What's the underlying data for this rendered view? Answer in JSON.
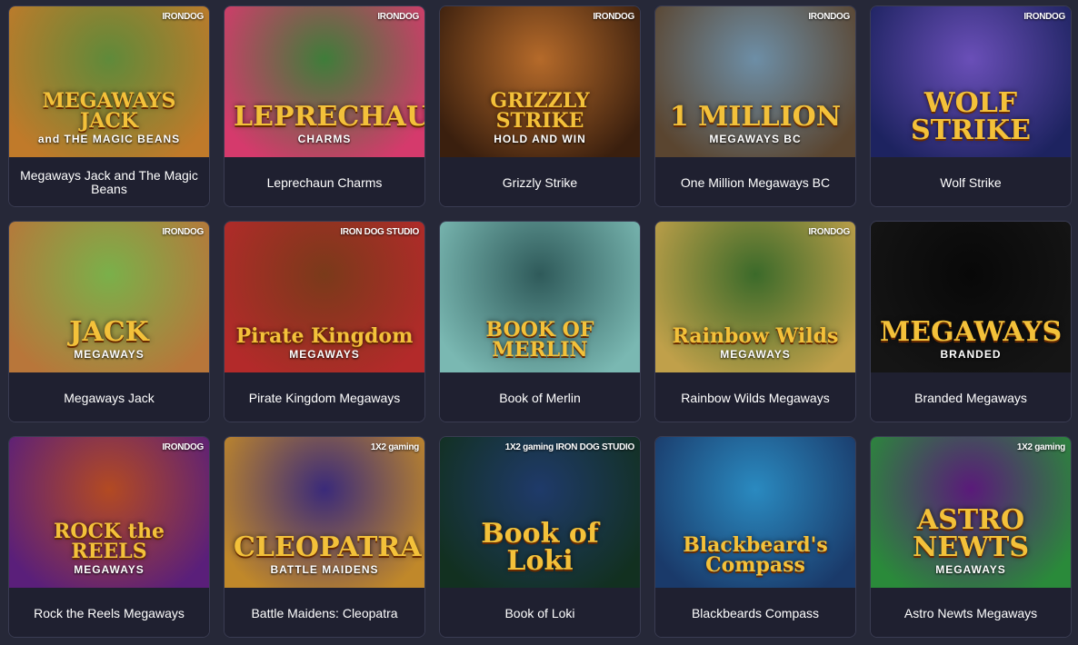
{
  "games": [
    {
      "title": "Megaways Jack and The Magic Beans",
      "logo": "MEGAWAYS JACK",
      "logo_sub": "and THE MAGIC BEANS",
      "provider": "IRONDOG",
      "bg": [
        "#5f8a3a",
        "#c07a2a"
      ]
    },
    {
      "title": "Leprechaun Charms",
      "logo": "LEPRECHAUN",
      "logo_sub": "CHARMS",
      "provider": "IRONDOG",
      "bg": [
        "#3f7d3a",
        "#d53a6c"
      ]
    },
    {
      "title": "Grizzly Strike",
      "logo": "GRIZZLY STRIKE",
      "logo_sub": "HOLD AND WIN",
      "provider": "IRONDOG",
      "bg": [
        "#b56a2a",
        "#3a1f0e"
      ]
    },
    {
      "title": "One Million Megaways BC",
      "logo": "1 MILLION",
      "logo_sub": "MEGAWAYS BC",
      "provider": "IRONDOG",
      "bg": [
        "#6d8ea6",
        "#5a4530"
      ]
    },
    {
      "title": "Wolf Strike",
      "logo": "WOLF STRIKE",
      "logo_sub": "",
      "provider": "IRONDOG",
      "bg": [
        "#6a4fb8",
        "#1d2360"
      ]
    },
    {
      "title": "Megaways Jack",
      "logo": "JACK",
      "logo_sub": "MEGAWAYS",
      "provider": "IRONDOG",
      "bg": [
        "#7ab04a",
        "#b8763a"
      ]
    },
    {
      "title": "Pirate Kingdom Megaways",
      "logo": "Pirate Kingdom",
      "logo_sub": "MEGAWAYS",
      "provider": "IRON DOG STUDIO",
      "bg": [
        "#7a3a1a",
        "#b32a2a"
      ]
    },
    {
      "title": "Book of Merlin",
      "logo": "BOOK OF MERLIN",
      "logo_sub": "",
      "provider": "",
      "bg": [
        "#2f5a5a",
        "#7ab8b2"
      ]
    },
    {
      "title": "Rainbow Wilds Megaways",
      "logo": "Rainbow Wilds",
      "logo_sub": "MEGAWAYS",
      "provider": "IRONDOG",
      "bg": [
        "#3b6a2a",
        "#c0a04a"
      ]
    },
    {
      "title": "Branded Megaways",
      "logo": "MEGAWAYS",
      "logo_sub": "BRANDED",
      "provider": "",
      "bg": [
        "#080808",
        "#151515"
      ]
    },
    {
      "title": "Rock the Reels Megaways",
      "logo": "ROCK the REELS",
      "logo_sub": "MEGAWAYS",
      "provider": "IRONDOG",
      "bg": [
        "#b34a22",
        "#5a1f7a"
      ]
    },
    {
      "title": "Battle Maidens: Cleopatra",
      "logo": "CLEOPATRA",
      "logo_sub": "BATTLE MAIDENS",
      "provider": "1X2 gaming",
      "bg": [
        "#3a2a7a",
        "#c0882a"
      ]
    },
    {
      "title": "Book of Loki",
      "logo": "Book of Loki",
      "logo_sub": "",
      "provider": "1X2 gaming IRON DOG STUDIO",
      "bg": [
        "#1f3a6a",
        "#123020"
      ]
    },
    {
      "title": "Blackbeards Compass",
      "logo": "Blackbeard's Compass",
      "logo_sub": "",
      "provider": "",
      "bg": [
        "#2a8ac0",
        "#1a3a6a"
      ]
    },
    {
      "title": "Astro Newts Megaways",
      "logo": "ASTRO NEWTS",
      "logo_sub": "MEGAWAYS",
      "provider": "1X2 gaming",
      "bg": [
        "#5a1a7a",
        "#2a8a3a"
      ]
    }
  ]
}
